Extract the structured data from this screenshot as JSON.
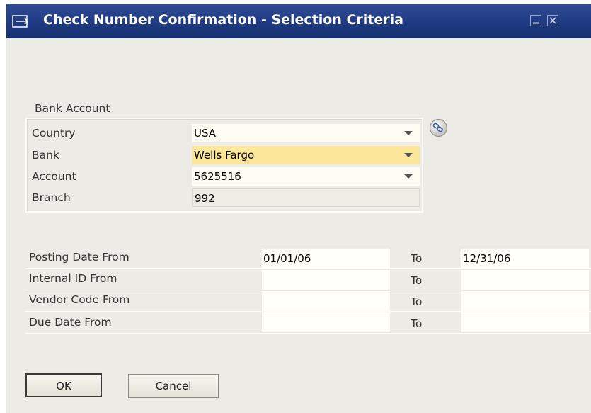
{
  "window": {
    "title": "Check Number Confirmation - Selection Criteria",
    "icons": [
      "form-icon",
      "minimize-icon",
      "close-icon"
    ]
  },
  "bank_account": {
    "title": "Bank Account",
    "rows": [
      {
        "label": "Country",
        "value": "USA",
        "type": "dropdown"
      },
      {
        "label": "Bank",
        "value": "Wells Fargo",
        "type": "dropdown"
      },
      {
        "label": "Account",
        "value": "5625516",
        "type": "dropdown"
      },
      {
        "label": "Branch",
        "value": "992",
        "type": "readonly"
      }
    ],
    "link_icon": "chain-link-icon"
  },
  "criteria": [
    {
      "label": "Posting Date From",
      "from": "01/01/06",
      "to_label": "To",
      "to": "12/31/06"
    },
    {
      "label": "Internal ID From",
      "from": "",
      "to_label": "To",
      "to": ""
    },
    {
      "label": "Vendor Code From",
      "from": "",
      "to_label": "To",
      "to": ""
    },
    {
      "label": "Due Date From",
      "from": "",
      "to_label": "To",
      "to": ""
    }
  ],
  "buttons": {
    "ok": "OK",
    "cancel": "Cancel"
  },
  "colors": {
    "titlebar": "#1f3a82",
    "background": "#ecebe5",
    "highlight": "#fde79a",
    "field": "#fffdf3"
  }
}
